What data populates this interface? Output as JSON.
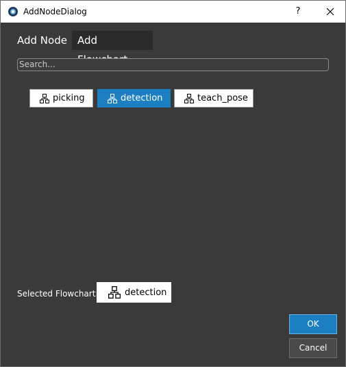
{
  "window": {
    "title": "AddNodeDialog",
    "help_label": "?"
  },
  "tabs": [
    {
      "label": "Add Node",
      "active": false
    },
    {
      "label": "Add Flowchart",
      "active": true
    }
  ],
  "search": {
    "placeholder": "Search...",
    "value": ""
  },
  "flowcharts": [
    {
      "label": "picking",
      "icon": "flowchart-icon",
      "selected": false
    },
    {
      "label": "detection",
      "icon": "flowchart-icon",
      "selected": true
    },
    {
      "label": "teach_pose",
      "icon": "flowchart-icon",
      "selected": false
    }
  ],
  "selection": {
    "label": "Selected Flowchart:",
    "value": "detection",
    "icon": "flowchart-icon"
  },
  "buttons": {
    "ok_label": "OK",
    "cancel_label": "Cancel"
  },
  "colors": {
    "accent": "#1c7fc1",
    "background": "#3a3a3a"
  }
}
